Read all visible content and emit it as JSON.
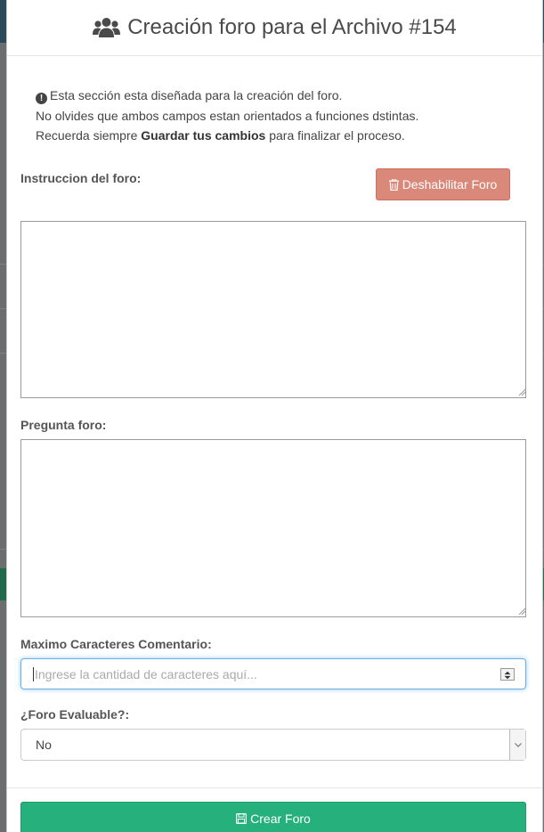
{
  "modal": {
    "title": "Creación foro para el Archivo #154"
  },
  "info": {
    "line1": "Esta sección esta diseñada para la creación del foro.",
    "line2": "No olvides que ambos campos estan orientados a funciones dstintas.",
    "line3_prefix": "Recuerda siempre ",
    "line3_bold": "Guardar tus cambios",
    "line3_suffix": " para finalizar el proceso."
  },
  "instruccion": {
    "label": "Instruccion del foro:",
    "value": ""
  },
  "disable_button": {
    "label": "Deshabilitar Foro"
  },
  "pregunta": {
    "label": "Pregunta foro:",
    "value": ""
  },
  "max_chars": {
    "label": "Maximo Caracteres Comentario:",
    "placeholder": "Ingrese la cantidad de caracteres aquí..."
  },
  "evaluable": {
    "label": "¿Foro Evaluable?:",
    "selected": "No"
  },
  "create_button": {
    "label": "Crear Foro"
  },
  "colors": {
    "danger": "#d9887a",
    "success": "#26b07c",
    "focus": "#66afe9"
  },
  "icons": {
    "title": "users-icon",
    "info": "exclamation-circle-icon",
    "disable": "trash-icon",
    "create": "save-icon"
  }
}
